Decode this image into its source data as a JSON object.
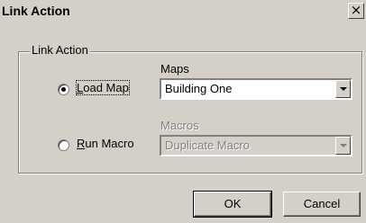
{
  "dialog": {
    "title": "Link Action",
    "close_label": "×"
  },
  "group": {
    "legend": "Link Action"
  },
  "options": {
    "load_map": {
      "accel": "L",
      "rest": "oad Map",
      "selected": true
    },
    "run_macro": {
      "accel": "R",
      "rest": "un Macro",
      "selected": false
    }
  },
  "maps": {
    "label": "Maps",
    "value": "Building One"
  },
  "macros": {
    "label": "Macros",
    "value": "Duplicate Macro",
    "disabled": true
  },
  "buttons": {
    "ok": "OK",
    "cancel": "Cancel"
  },
  "icons": {
    "close": "close-icon",
    "dropdown": "chevron-down-icon"
  },
  "colors": {
    "face": "#d4d0c8",
    "disabled_text": "#808080"
  }
}
